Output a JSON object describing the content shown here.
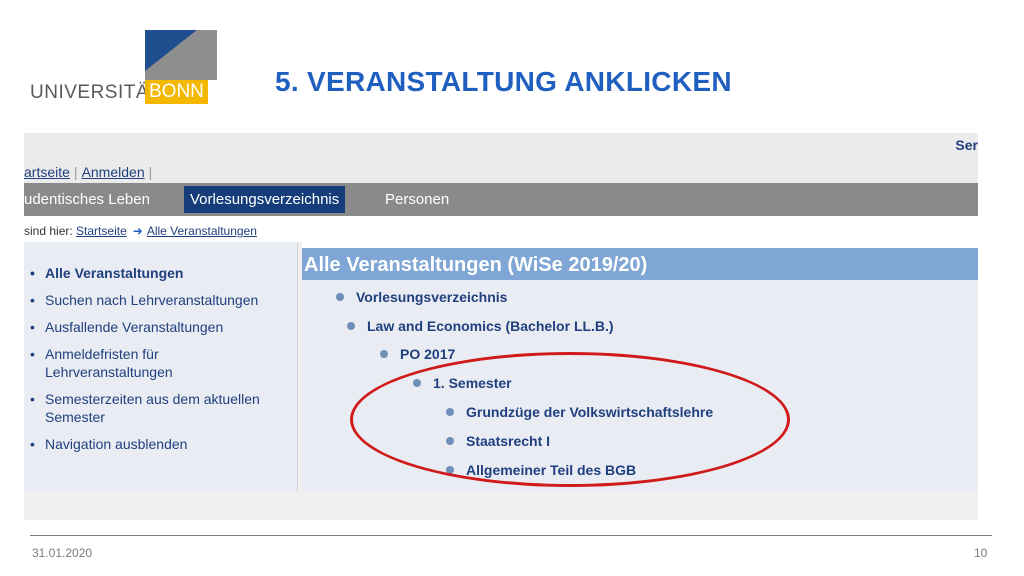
{
  "logo": {
    "university": "UNIVERSITÄT",
    "city": "BONN"
  },
  "slide": {
    "title": "5. VERANSTALTUNG ANKLICKEN"
  },
  "browser": {
    "top_right_link": "Ser",
    "top_links": [
      "artseite",
      "Anmelden"
    ],
    "nav": {
      "items": [
        "udentisches Leben",
        "Vorlesungsverzeichnis",
        "Personen"
      ],
      "active": "Vorlesungsverzeichnis"
    },
    "breadcrumb": {
      "prefix": "sind hier:",
      "items": [
        "Startseite",
        "Alle Veranstaltungen"
      ]
    }
  },
  "sidebar": {
    "items": [
      {
        "label": "Alle Veranstaltungen",
        "active": true
      },
      {
        "label": "Suchen nach Lehrveranstaltungen"
      },
      {
        "label": "Ausfallende Veranstaltungen"
      },
      {
        "label": "Anmeldefristen für Lehrveranstaltungen"
      },
      {
        "label": "Semesterzeiten aus dem aktuellen Semester"
      },
      {
        "label": "Navigation ausblenden"
      }
    ]
  },
  "main": {
    "heading": "Alle Veranstaltungen (WiSe 2019/20)",
    "tree": [
      {
        "label": "Vorlesungsverzeichnis",
        "level": 0
      },
      {
        "label": "Law and Economics (Bachelor LL.B.)",
        "level": 1
      },
      {
        "label": "PO 2017",
        "level": 2
      },
      {
        "label": "1. Semester",
        "level": 3
      },
      {
        "label": "Grundzüge der Volkswirtschaftslehre",
        "level": 4
      },
      {
        "label": "Staatsrecht I",
        "level": 4
      },
      {
        "label": "Allgemeiner Teil des BGB",
        "level": 4
      }
    ]
  },
  "annotation": {
    "color": "#d01a1a"
  },
  "footer": {
    "date": "31.01.2020",
    "page": "10"
  },
  "colors": {
    "title_blue": "#1f5fbf",
    "nav_active": "#163d7a",
    "link_blue": "#1f3f7f",
    "logo_yellow": "#f5b800"
  }
}
